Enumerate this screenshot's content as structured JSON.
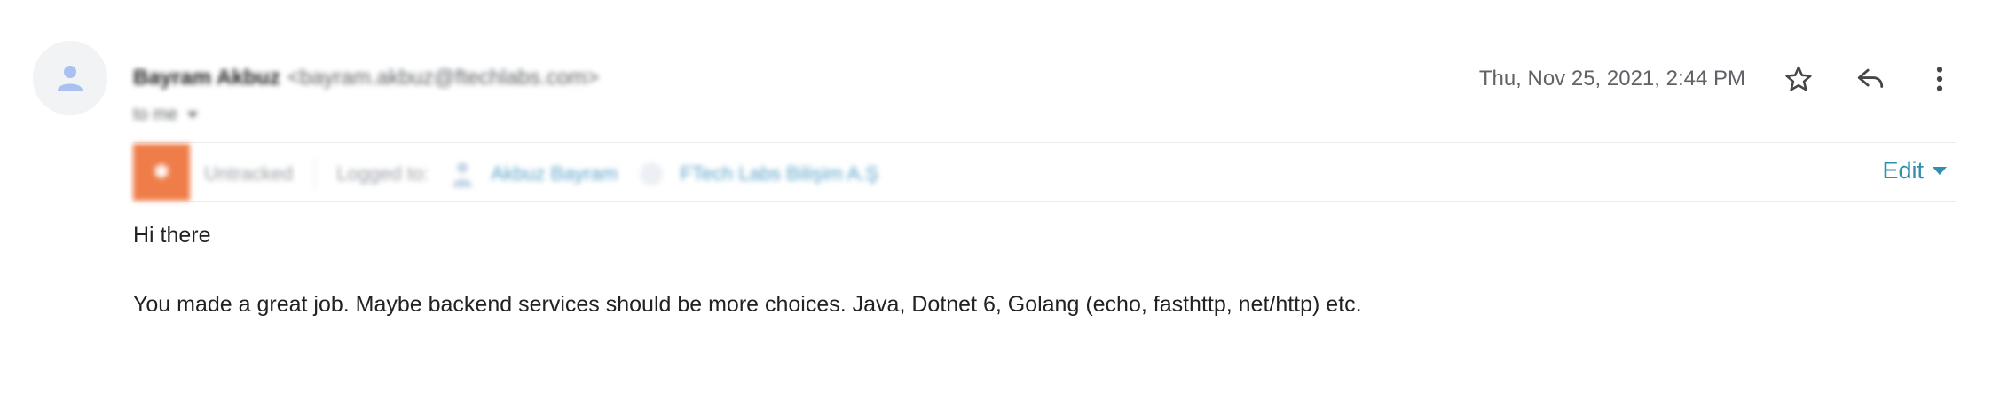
{
  "sender": {
    "name": "Bayram Akbuz",
    "email": "<bayram.akbuz@ftechlabs.com>",
    "recipient": "to me"
  },
  "header": {
    "date": "Thu, Nov 25, 2021, 2:44 PM",
    "icons": [
      "star-icon",
      "reply-icon",
      "more-vert-icon"
    ]
  },
  "crm": {
    "status": "Untracked",
    "logged_in_label": "Logged to:",
    "contact": "Akbuz Bayram",
    "company": "FTech Labs Bilişim A.Ş",
    "edit_label": "Edit"
  },
  "message": {
    "paragraphs": [
      "Hi there",
      "You made a great job. Maybe backend services should be more choices. Java, Dotnet 6, Golang (echo, fasthttp, net/http) etc."
    ]
  },
  "colors": {
    "crm_orange": "#ef7d4a",
    "link_blue": "#5ba3c9",
    "edit_blue": "#2f8fb0",
    "meta_gray": "#5f6368"
  }
}
